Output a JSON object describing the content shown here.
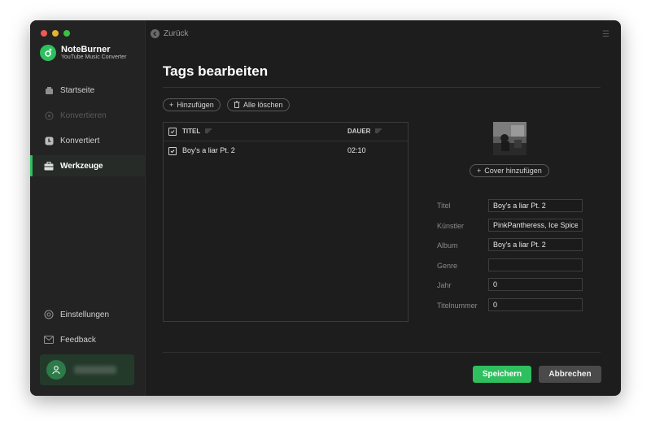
{
  "window": {
    "traffic_colors": [
      "#ee5b55",
      "#e3b431",
      "#39c142"
    ]
  },
  "app": {
    "name": "NoteBurner",
    "subtitle": "YouTube Music Converter"
  },
  "sidebar": {
    "items": [
      {
        "label": "Startseite",
        "icon": "home-icon",
        "state": "normal"
      },
      {
        "label": "Konvertieren",
        "icon": "convert-icon",
        "state": "disabled"
      },
      {
        "label": "Konvertiert",
        "icon": "clock-icon",
        "state": "normal"
      },
      {
        "label": "Werkzeuge",
        "icon": "toolbox-icon",
        "state": "active"
      }
    ],
    "bottom": [
      {
        "label": "Einstellungen",
        "icon": "gear-icon"
      },
      {
        "label": "Feedback",
        "icon": "mail-icon"
      }
    ],
    "user": {
      "avatar_icon": "user-icon"
    }
  },
  "header": {
    "back_label": "Zurück",
    "title": "Tags bearbeiten"
  },
  "toolbar": {
    "add_label": "Hinzufügen",
    "clear_label": "Alle löschen"
  },
  "table": {
    "columns": [
      "TITEL",
      "DAUER"
    ],
    "rows": [
      {
        "title": "Boy's a liar Pt. 2",
        "duration": "02:10",
        "checked": true
      }
    ]
  },
  "tags": {
    "cover_button": "Cover hinzufügen",
    "fields": [
      {
        "label": "Titel",
        "value": "Boy's a liar Pt. 2"
      },
      {
        "label": "Künstler",
        "value": "PinkPantheress, Ice Spice"
      },
      {
        "label": "Album",
        "value": "Boy's a liar Pt. 2"
      },
      {
        "label": "Genre",
        "value": ""
      },
      {
        "label": "Jahr",
        "value": "0"
      },
      {
        "label": "Titelnummer",
        "value": "0"
      }
    ]
  },
  "actions": {
    "save_label": "Speichern",
    "cancel_label": "Abbrechen"
  },
  "colors": {
    "accent": "#2fbf5f",
    "background": "#1d1d1d",
    "sidebar": "#232323"
  }
}
